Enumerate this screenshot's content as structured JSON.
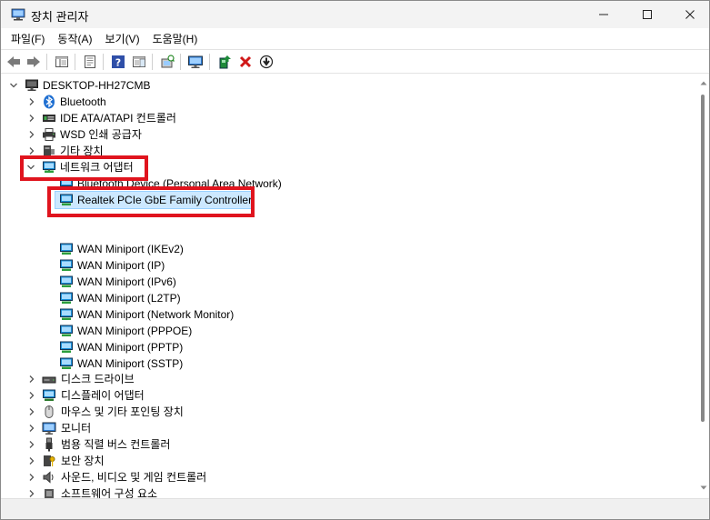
{
  "window": {
    "title": "장치 관리자",
    "minimize_glyph": "—",
    "maximize_glyph": "☐",
    "close_glyph": "✕"
  },
  "menu": [
    "파일(F)",
    "동작(A)",
    "보기(V)",
    "도움말(H)"
  ],
  "toolbar_icons": [
    "back-icon",
    "forward-icon",
    "show-hide-console-tree-icon",
    "properties-icon",
    "help-icon",
    "action-pane-icon",
    "scan-hardware-icon",
    "monitor-icon",
    "update-driver-icon",
    "uninstall-icon",
    "disable-icon"
  ],
  "tree": {
    "root": "DESKTOP-HH27CMB",
    "categories_before": [
      {
        "label": "Bluetooth",
        "icon": "bluetooth-icon"
      },
      {
        "label": "IDE ATA/ATAPI 컨트롤러",
        "icon": "ide-controller-icon"
      },
      {
        "label": "WSD 인쇄 공급자",
        "icon": "printer-icon"
      },
      {
        "label": "기타 장치",
        "icon": "other-devices-icon"
      }
    ],
    "network": {
      "label": "네트워크 어댑터",
      "children": [
        {
          "label": "Bluetooth Device (Personal Area Network)"
        },
        {
          "label": "Realtek PCIe GbE Family Controller",
          "selected": true
        },
        {
          "label": "WAN Miniport (IKEv2)"
        },
        {
          "label": "WAN Miniport (IP)"
        },
        {
          "label": "WAN Miniport (IPv6)"
        },
        {
          "label": "WAN Miniport (L2TP)"
        },
        {
          "label": "WAN Miniport (Network Monitor)"
        },
        {
          "label": "WAN Miniport (PPPOE)"
        },
        {
          "label": "WAN Miniport (PPTP)"
        },
        {
          "label": "WAN Miniport (SSTP)"
        }
      ]
    },
    "categories_after": [
      {
        "label": "디스크 드라이브",
        "icon": "disk-drive-icon"
      },
      {
        "label": "디스플레이 어댑터",
        "icon": "display-adapter-icon"
      },
      {
        "label": "마우스 및 기타 포인팅 장치",
        "icon": "mouse-icon"
      },
      {
        "label": "모니터",
        "icon": "monitor-icon"
      },
      {
        "label": "범용 직렬 버스 컨트롤러",
        "icon": "usb-icon"
      },
      {
        "label": "보안 장치",
        "icon": "security-device-icon"
      },
      {
        "label": "사운드, 비디오 및 게임 컨트롤러",
        "icon": "sound-icon"
      },
      {
        "label": "소프트웨어 구성 요소",
        "icon": "software-component-icon"
      }
    ]
  },
  "colors": {
    "highlight_box": "#e0141e",
    "selection": "#cce8ff",
    "network_icon": "#1a8fd8"
  }
}
